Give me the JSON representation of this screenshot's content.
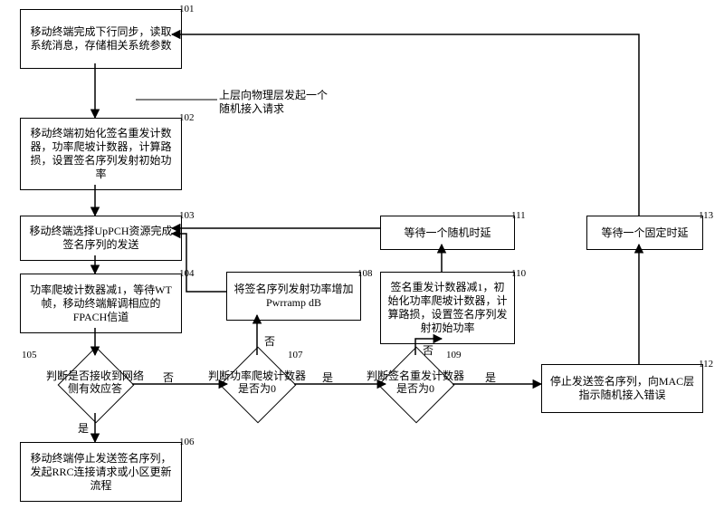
{
  "nodes": {
    "n101": {
      "num": "101",
      "text": "移动终端完成下行同步，读取系统消息，存储相关系统参数"
    },
    "n102": {
      "num": "102",
      "text": "移动终端初始化签名重发计数器，功率爬坡计数器，计算路损，设置签名序列发射初始功率"
    },
    "n103": {
      "num": "103",
      "text": "移动终端选择UpPCH资源完成签名序列的发送"
    },
    "n104": {
      "num": "104",
      "text": "功率爬坡计数器减1，等待WT帧，移动终端解调相应的FPACH信道"
    },
    "n105": {
      "num": "105",
      "text": "判断是否接收到网络侧有效应答"
    },
    "n106": {
      "num": "106",
      "text": "移动终端停止发送签名序列，发起RRC连接请求或小区更新流程"
    },
    "n107": {
      "num": "107",
      "text": "判断功率爬坡计数器是否为0"
    },
    "n108": {
      "num": "108",
      "text": "将签名序列发射功率增加Pwrramp dB"
    },
    "n109": {
      "num": "109",
      "text": "判断签名重发计数器是否为0"
    },
    "n110": {
      "num": "110",
      "text": "签名重发计数器减1，初始化功率爬坡计数器，计算路损，设置签名序列发射初始功率"
    },
    "n111": {
      "num": "111",
      "text": "等待一个随机时延"
    },
    "n112": {
      "num": "112",
      "text": "停止发送签名序列，向MAC层指示随机接入错误"
    },
    "n113": {
      "num": "113",
      "text": "等待一个固定时延"
    }
  },
  "callout": "上层向物理层发起一个随机接入请求",
  "edge_labels": {
    "yes": "是",
    "no": "否"
  },
  "chart_data": {
    "type": "diagram",
    "title": "随机接入流程图",
    "edges": [
      {
        "from": "101",
        "to": "102"
      },
      {
        "from": "102",
        "to": "103",
        "note": "上层向物理层发起一个随机接入请求"
      },
      {
        "from": "103",
        "to": "104"
      },
      {
        "from": "104",
        "to": "105"
      },
      {
        "from": "105",
        "to": "106",
        "label": "是"
      },
      {
        "from": "105",
        "to": "107",
        "label": "否"
      },
      {
        "from": "107",
        "to": "108",
        "label": "否"
      },
      {
        "from": "108",
        "to": "103"
      },
      {
        "from": "107",
        "to": "109",
        "label": "是"
      },
      {
        "from": "109",
        "to": "110",
        "label": "否"
      },
      {
        "from": "110",
        "to": "111"
      },
      {
        "from": "111",
        "to": "103"
      },
      {
        "from": "109",
        "to": "112",
        "label": "是"
      },
      {
        "from": "112",
        "to": "113"
      },
      {
        "from": "113",
        "to": "101"
      }
    ]
  }
}
